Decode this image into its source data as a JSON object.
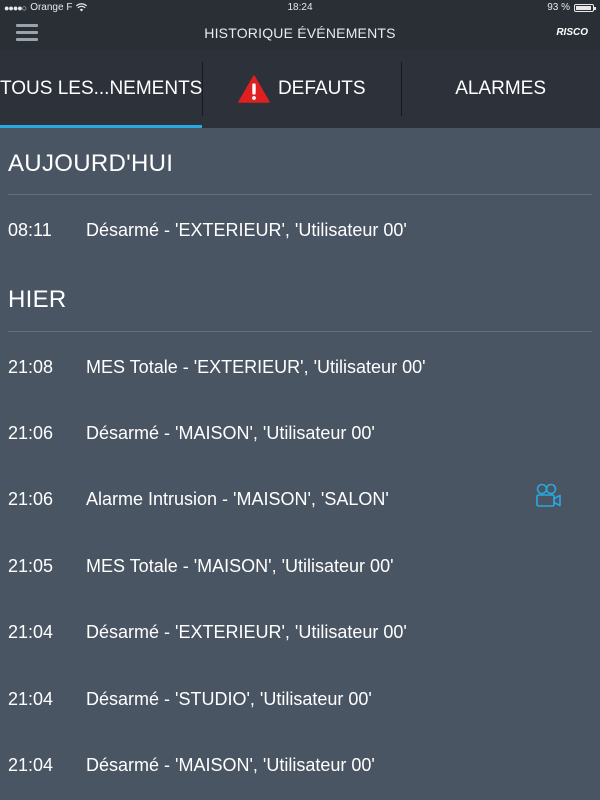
{
  "statusbar": {
    "signal": "●●●●○",
    "carrier": "Orange F",
    "time": "18:24",
    "battery": "93 %"
  },
  "navbar": {
    "title": "HISTORIQUE ÉVÉNEMENTS",
    "logo": "RISCO"
  },
  "tabs": [
    {
      "label": "TOUS LES...NEMENTS",
      "active": true
    },
    {
      "label": "DEFAUTS",
      "icon": "warning-triangle-icon"
    },
    {
      "label": "ALARMES"
    }
  ],
  "sections": {
    "today": {
      "title": "AUJOURD'HUI",
      "events": [
        {
          "time": "08:11",
          "description": "Désarmé - 'EXTERIEUR', 'Utilisateur 00'"
        }
      ]
    },
    "yesterday": {
      "title": "HIER",
      "events": [
        {
          "time": "21:08",
          "description": "MES Totale - 'EXTERIEUR', 'Utilisateur 00'"
        },
        {
          "time": "21:06",
          "description": "Désarmé - 'MAISON', 'Utilisateur 00'"
        },
        {
          "time": "21:06",
          "description": "Alarme Intrusion - 'MAISON', 'SALON'",
          "icon": "video-camera-icon"
        },
        {
          "time": "21:05",
          "description": "MES Totale - 'MAISON', 'Utilisateur 00'"
        },
        {
          "time": "21:04",
          "description": "Désarmé - 'EXTERIEUR', 'Utilisateur 00'"
        },
        {
          "time": "21:04",
          "description": "Désarmé - 'STUDIO', 'Utilisateur 00'"
        },
        {
          "time": "21:04",
          "description": "Désarmé - 'MAISON', 'Utilisateur 00'"
        }
      ]
    }
  },
  "colors": {
    "background": "#4a5563",
    "bar": "#2c313a",
    "accent": "#29a8e0",
    "warning": "#e02020",
    "camera": "#29a8e0"
  }
}
